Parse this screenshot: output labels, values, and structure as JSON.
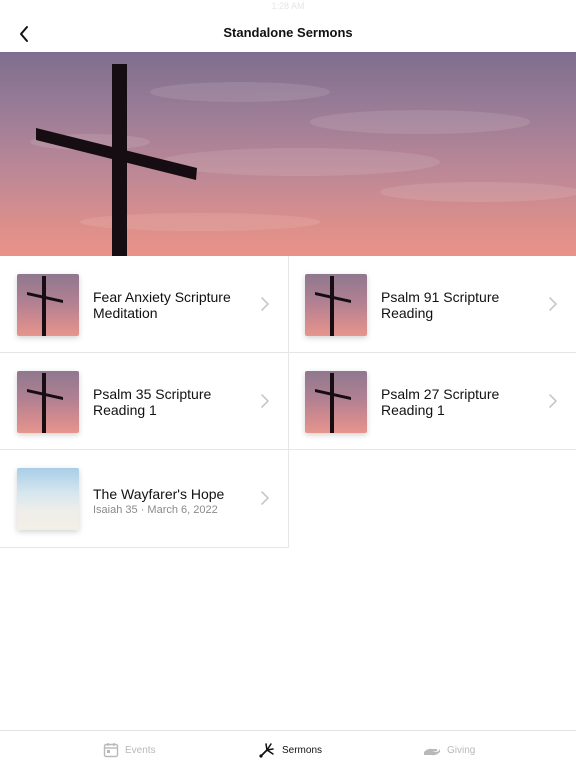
{
  "status_bar": {
    "time": "1:28 AM"
  },
  "nav": {
    "title": "Standalone Sermons",
    "back_icon": "chevron-left-icon"
  },
  "sermons": [
    {
      "title": "Fear Anxiety Scripture Meditation",
      "subtitle": "",
      "thumbnail": "cross-sunset"
    },
    {
      "title": "Psalm 91 Scripture Reading",
      "subtitle": "",
      "thumbnail": "cross-sunset"
    },
    {
      "title": "Psalm 35 Scripture Reading 1",
      "subtitle": "",
      "thumbnail": "cross-sunset"
    },
    {
      "title": "Psalm 27 Scripture Reading 1",
      "subtitle": "",
      "thumbnail": "cross-sunset"
    },
    {
      "title": "The Wayfarer's Hope",
      "subtitle": "Isaiah 35 · March 6, 2022",
      "thumbnail": "bright-sky"
    }
  ],
  "tab_bar": {
    "events": "Events",
    "sermons": "Sermons",
    "giving": "Giving",
    "active": "sermons"
  },
  "colors": {
    "active_tab": "#111111",
    "inactive_tab": "#b9b9b9",
    "divider": "#e6e6e6"
  }
}
